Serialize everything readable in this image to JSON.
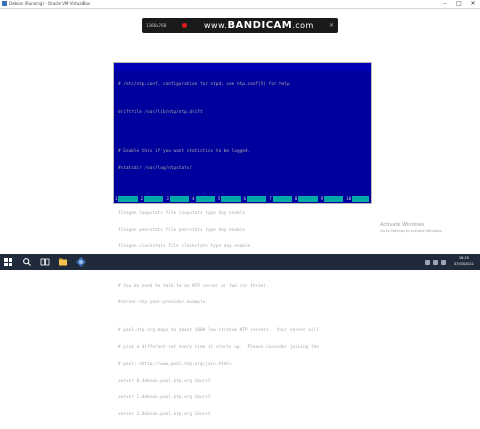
{
  "window": {
    "title": "Debian (Running) - Oracle VM VirtualBox",
    "min": "–",
    "max": "□",
    "close": "✕"
  },
  "menubar": [
    "File",
    "Machine",
    "View",
    "Input",
    "Devices",
    "Help"
  ],
  "recorder": {
    "resolution": "1366x768",
    "watermark_prefix": "www.",
    "watermark": "BANDICAM",
    "watermark_suffix": ".com",
    "close": "✕"
  },
  "console": {
    "lines": [
      "# /etc/ntp.conf, configuration for ntpd; see ntp.conf(5) for help",
      "",
      "driftfile /var/lib/ntp/ntp.drift",
      "",
      "",
      "# Enable this if you want statistics to be logged.",
      "#statsdir /var/log/ntpstats/",
      "",
      "statistics loopstats peerstats clockstats",
      "filegen loopstats file loopstats type day enable",
      "filegen peerstats file peerstats type day enable",
      "filegen clockstats file clockstats type day enable",
      "",
      "",
      "# You do need to talk to an NTP server or two (or three).",
      "#server ntp.your-provider.example",
      "",
      "# pool.ntp.org maps to about 1000 low-stratum NTP servers.  Your server will",
      "# pick a different set every time it starts up.  Please consider joining the",
      "# pool: <http://www.pool.ntp.org/join.html>",
      "server 0.debian.pool.ntp.org iburst",
      "server 1.debian.pool.ntp.org iburst",
      "server 2.debian.pool.ntp.org iburst"
    ],
    "function_keys": [
      "1",
      "2",
      "3",
      "4",
      "5",
      "6",
      "7",
      "8",
      "9",
      "10"
    ]
  },
  "activation": {
    "line1": "Activate Windows",
    "line2": "Go to Settings to activate Windows."
  },
  "taskbar": {
    "time": "18:25",
    "date": "07/03/2021"
  },
  "colors": {
    "console_bg": "#00009c",
    "console_text": "#aaaaaa",
    "keybar_cell": "#00a8a8",
    "taskbar": "#1f2a3a",
    "record_dot": "#e21b1b"
  }
}
